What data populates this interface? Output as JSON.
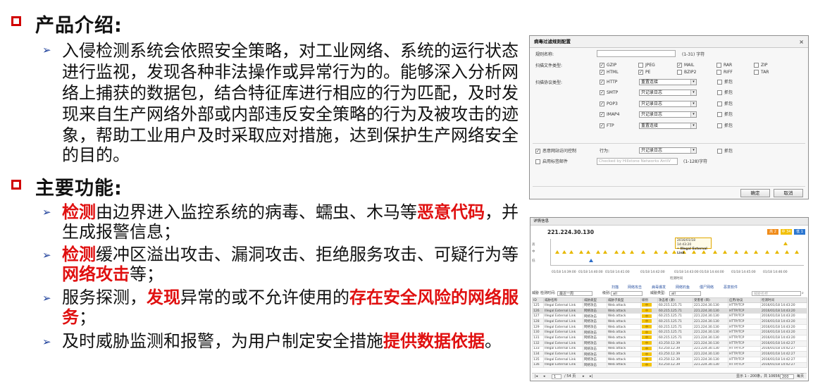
{
  "sections": [
    {
      "title": "产品介绍:",
      "paragraph_lines": [
        "入侵检测系统会依照安全策略，对工业网络、系统的运行状态",
        "进行监视，发现各种非法操作或异常行为的。能够深入分析网",
        "络上捕获的数据包，结合特征库进行相应的行为匹配，及时发",
        "现来自生产网络外部或内部违反安全策略的行为及被攻击的迹",
        "象，帮助工业用户及时采取应对措施，达到保护生产网络安全",
        "的目的。"
      ]
    },
    {
      "title": "主要功能:",
      "items": [
        {
          "l1a": "检测",
          "l1b": "由边界进入监控系统的病毒、蠕虫、木马等",
          "l1c": "恶意代码",
          "l1d": "，并",
          "l2": "生成报警信息；"
        },
        {
          "l1a": "检测",
          "l1b": "缓冲区溢出攻击、漏洞攻击、拒绝服务攻击、可疑行为等",
          "l2a": "网络攻击",
          "l2b": "等；"
        },
        {
          "l1a": "服务探测，",
          "l1b": "发现",
          "l1c": "异常的或不允许使用的",
          "l1d": "存在安全风险的网络服",
          "l2a": "务",
          "l2b": "；"
        },
        {
          "l1a": "及时威胁监测和报警，为用户制定安全措施",
          "l1b": "提供数据依据",
          "l1c": "。"
        }
      ]
    }
  ],
  "dialog": {
    "title": "病毒过滤规则配置",
    "close": "×",
    "rule_name_label": "规则名称:",
    "rule_name_hint": "(1-31) 字符",
    "file_type_label": "扫描文件类型:",
    "file_types": [
      {
        "name": "GZIP",
        "checked": true
      },
      {
        "name": "JPEG",
        "checked": false
      },
      {
        "name": "MAIL",
        "checked": true
      },
      {
        "name": "RAR",
        "checked": false
      },
      {
        "name": "ZIP",
        "checked": false
      },
      {
        "name": "HTML",
        "checked": true
      },
      {
        "name": "PE",
        "checked": true
      },
      {
        "name": "BZIP2",
        "checked": false
      },
      {
        "name": "RIFF",
        "checked": false
      },
      {
        "name": "TAR",
        "checked": false
      }
    ],
    "protocol_label": "扫描协议类型:",
    "capture_label": "抓包",
    "protocols": [
      {
        "name": "HTTP",
        "action": "重置连接"
      },
      {
        "name": "SMTP",
        "action": "只记录日志"
      },
      {
        "name": "POP3",
        "action": "只记录日志"
      },
      {
        "name": "IMAP4",
        "action": "只记录日志"
      },
      {
        "name": "FTP",
        "action": "重置连接"
      }
    ],
    "malicious_label": "恶意网站访问控制",
    "behavior_label": "行为:",
    "behavior_value": "只记录日志",
    "sign_label": "启用标签邮件",
    "sign_placeholder": "Checked by Hillstone Networks AntiV",
    "sign_hint": "(1-128)字符",
    "ok": "确定",
    "cancel": "取消"
  },
  "monitor": {
    "title": "详情信息",
    "ip": "221.224.30.130",
    "tags": [
      {
        "label": "高 2",
        "color": "#f08c1a"
      },
      {
        "label": "中 34",
        "color": "#f2c00a"
      },
      {
        "label": "低 1",
        "color": "#2d77d0"
      }
    ],
    "y_labels": [
      "高",
      "中",
      "低"
    ],
    "tooltip_time": "2016/01/18 14:43:20",
    "tooltip_name": "• Illegal External Link",
    "time_ticks": [
      "01/18 14:39:00",
      "01/18 14:40:00",
      "01/18 14:41:00",
      "01/18 14:42:00",
      "01/18 14:43:00",
      "01/18 14:44:00",
      "01/18 14:45:00",
      "01/18 14:46:00"
    ],
    "axis_caption": "检测时间",
    "tabs": [
      "扫描",
      "网络攻击",
      "病毒爆发",
      "网络钓鱼",
      "僵尸网络",
      "恶意软件"
    ],
    "filter": {
      "l1": "威胁",
      "l2": "检测时间:",
      "v2": "最近一周",
      "l3": "级别:",
      "v3": "all",
      "l4": "威胁类型:",
      "v4": "all",
      "search": "威胁名称"
    },
    "columns": [
      "ID",
      "威胁名称",
      "威胁类型",
      "威胁子类型",
      "级别",
      "攻击者 (源)",
      "受害者 (目)",
      "应用/协议",
      "检测时间"
    ],
    "rows": [
      [
        "125",
        "Illegal External Link",
        "网络攻击",
        "Web attack",
        "中",
        "60.215.125.71",
        "221.224.30.130",
        "HTTP/TCP",
        "2016/01/18 14:43:20"
      ],
      [
        "126",
        "Illegal External Link",
        "网络攻击",
        "Web attack",
        "中",
        "60.215.125.71",
        "221.224.30.130",
        "HTTP/TCP",
        "2016/01/18 14:43:20"
      ],
      [
        "127",
        "Illegal External Link",
        "网络攻击",
        "Web attack",
        "中",
        "60.215.125.71",
        "221.224.30.130",
        "HTTP/TCP",
        "2016/01/18 14:43:20"
      ],
      [
        "128",
        "Illegal External Link",
        "网络攻击",
        "Web attack",
        "中",
        "60.215.125.71",
        "221.224.30.130",
        "HTTP/TCP",
        "2016/01/18 14:43:20"
      ],
      [
        "129",
        "Illegal External Link",
        "网络攻击",
        "Web attack",
        "中",
        "60.215.125.71",
        "221.224.30.130",
        "HTTP/TCP",
        "2016/01/18 14:43:20"
      ],
      [
        "130",
        "Illegal External Link",
        "网络攻击",
        "Web attack",
        "中",
        "60.215.125.71",
        "221.224.30.130",
        "HTTP/TCP",
        "2016/01/18 14:43:20"
      ],
      [
        "131",
        "Illegal External Link",
        "网络攻击",
        "Web attack",
        "中",
        "60.215.125.71",
        "221.224.30.130",
        "HTTP/TCP",
        "2016/01/18 14:43:20"
      ],
      [
        "132",
        "Illegal External Link",
        "网络攻击",
        "Web attack",
        "中",
        "43.250.12.39",
        "221.224.30.130",
        "HTTP/TCP",
        "2016/01/18 14:42:27"
      ],
      [
        "133",
        "Illegal External Link",
        "网络攻击",
        "Web attack",
        "中",
        "43.250.12.39",
        "221.224.30.130",
        "HTTP/TCP",
        "2016/01/18 14:42:27"
      ],
      [
        "134",
        "Illegal External Link",
        "网络攻击",
        "Web attack",
        "中",
        "43.250.12.39",
        "221.224.30.130",
        "HTTP/TCP",
        "2016/01/18 14:42:27"
      ],
      [
        "135",
        "Illegal External Link",
        "网络攻击",
        "Web attack",
        "中",
        "43.250.12.39",
        "221.224.30.130",
        "HTTP/TCP",
        "2016/01/18 14:42:27"
      ],
      [
        "136",
        "Illegal External Link",
        "网络攻击",
        "Web attack",
        "中",
        "43.250.12.39",
        "221.224.30.130",
        "HTTP/TCP",
        "2016/01/18 14:42:27"
      ]
    ],
    "pager": {
      "page": "1",
      "total": "/ 54 页",
      "info": "显示 1 - 200条，共 10656 条",
      "size": "200",
      "per": "每页"
    }
  }
}
